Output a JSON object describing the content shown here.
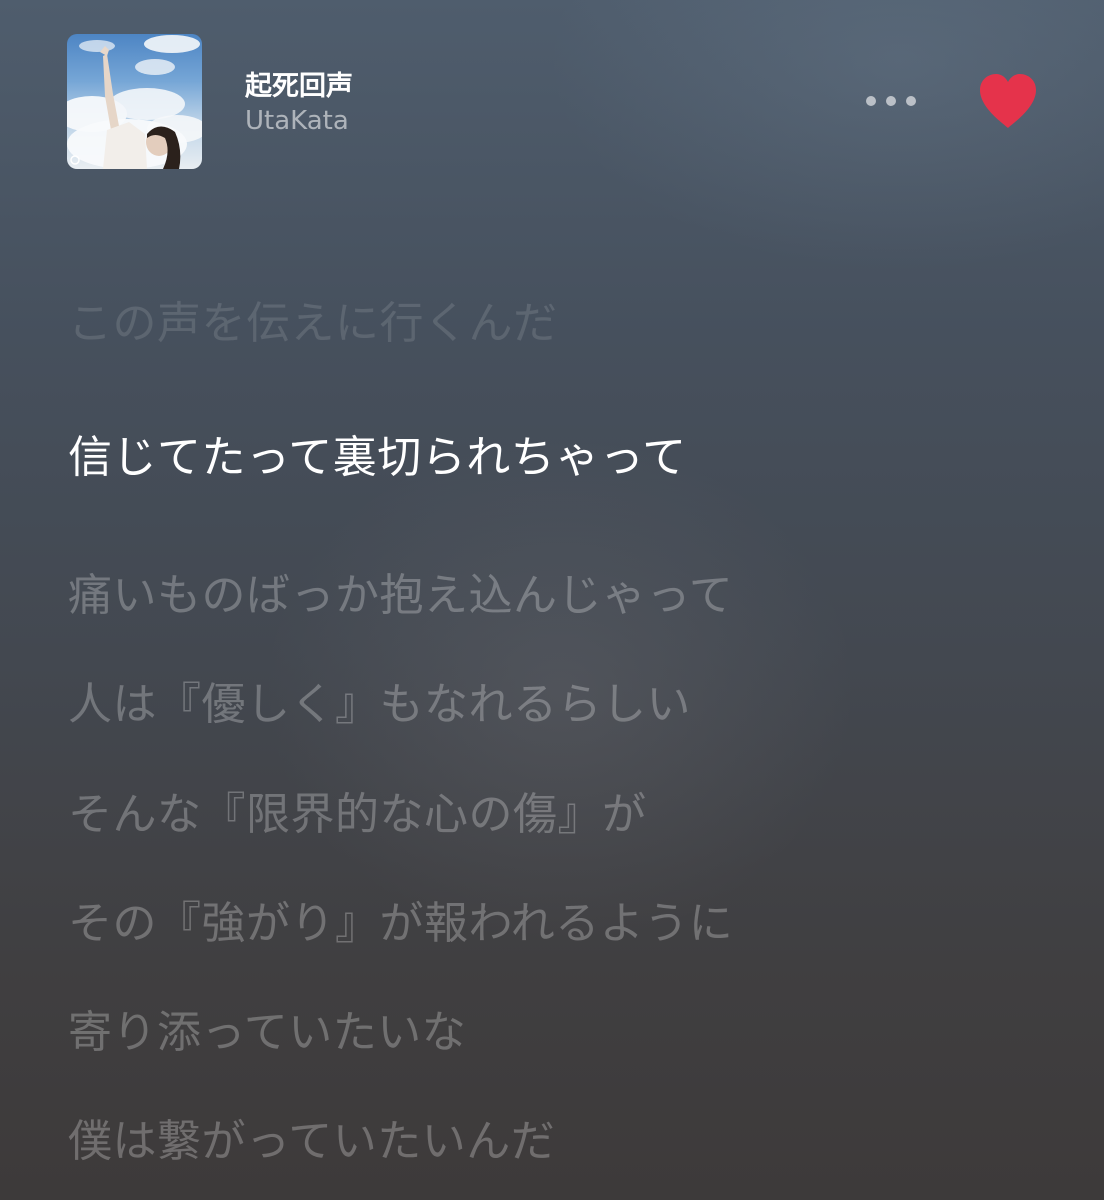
{
  "now_playing": {
    "title": "起死回声",
    "artist": "UtaKata",
    "artwork_icon": "album-artwork",
    "more_icon": "more-options-icon",
    "love_icon": "heart-filled-icon",
    "love_color": "#e5334b"
  },
  "lyrics": {
    "lines": [
      "この声を伝えに行くんだ",
      "信じてたって裏切られちゃって",
      "痛いものばっか抱え込んじゃって",
      "人は『優しく』もなれるらしい",
      "そんな『限界的な心の傷』が",
      "その『強がり』が報われるように",
      "寄り添っていたいな",
      "僕は繋がっていたいんだ"
    ]
  }
}
